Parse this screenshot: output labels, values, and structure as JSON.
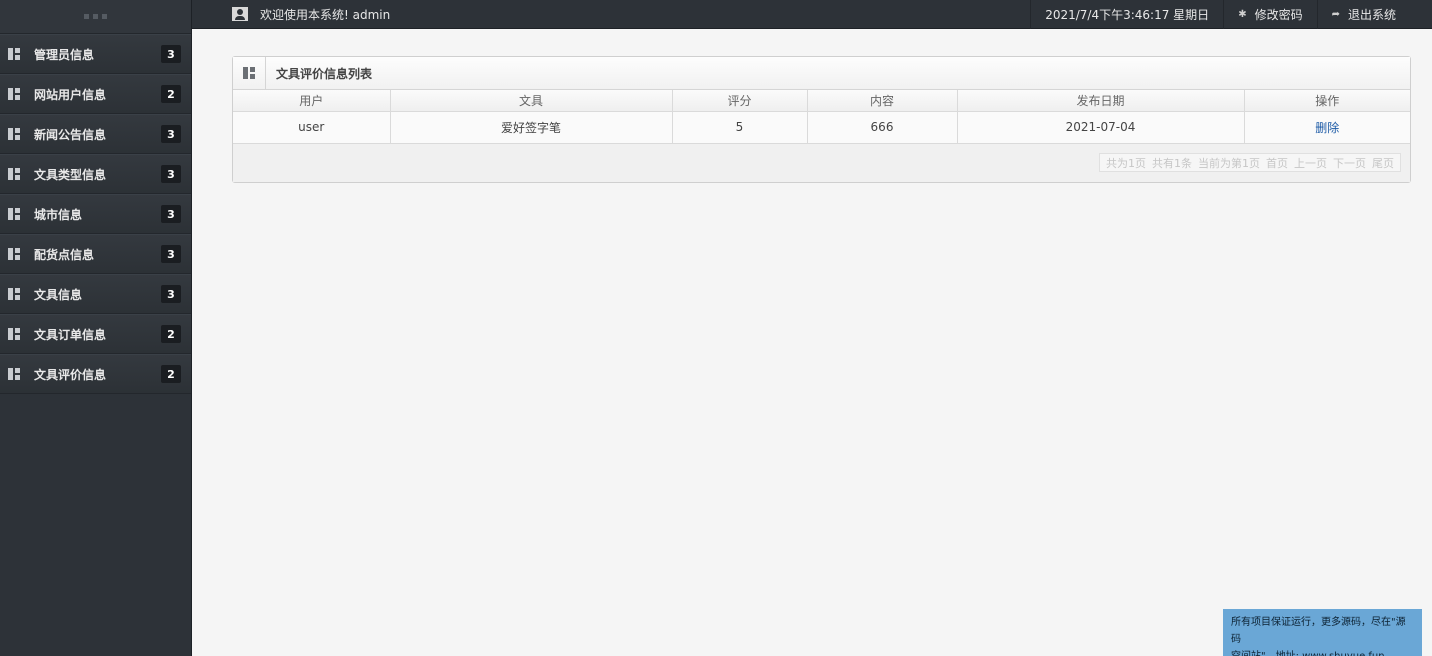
{
  "sidebar": {
    "items": [
      {
        "label": "管理员信息",
        "badge": "3"
      },
      {
        "label": "网站用户信息",
        "badge": "2"
      },
      {
        "label": "新闻公告信息",
        "badge": "3"
      },
      {
        "label": "文具类型信息",
        "badge": "3"
      },
      {
        "label": "城市信息",
        "badge": "3"
      },
      {
        "label": "配货点信息",
        "badge": "3"
      },
      {
        "label": "文具信息",
        "badge": "3"
      },
      {
        "label": "文具订单信息",
        "badge": "2"
      },
      {
        "label": "文具评价信息",
        "badge": "2"
      }
    ]
  },
  "topbar": {
    "welcome": "欢迎使用本系统! admin",
    "datetime": "2021/7/4下午3:46:17 星期日",
    "change_password": "修改密码",
    "logout": "退出系统"
  },
  "panel": {
    "title": "文具评价信息列表",
    "columns": [
      "用户",
      "文具",
      "评分",
      "内容",
      "发布日期",
      "操作"
    ],
    "rows": [
      {
        "user": "user",
        "item": "爱好签字笔",
        "score": "5",
        "content": "666",
        "date": "2021-07-04",
        "action": "删除"
      }
    ],
    "pager": {
      "total_pages": "共为1页",
      "total_items": "共有1条",
      "current": "当前为第1页",
      "first": "首页",
      "prev": "上一页",
      "next": "下一页",
      "last": "尾页"
    }
  },
  "notice": {
    "line1": "所有项目保证运行，更多源码，尽在\"源码",
    "line2": "空间站\"，地址: www.shuyue.fun"
  },
  "colors": {
    "sidebar_bg": "#2d3238",
    "content_bg": "#f5f5f5",
    "link": "#1c5aa6",
    "notice_bg": "#6aa7d6"
  }
}
